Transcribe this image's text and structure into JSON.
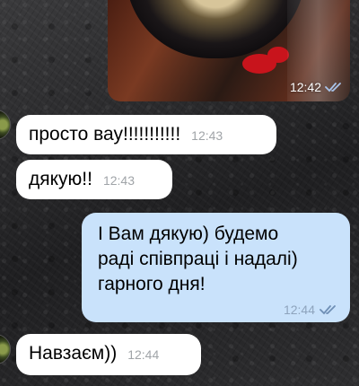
{
  "colors": {
    "incoming_bubble": "#ffffff",
    "outgoing_bubble": "#c9e2fb",
    "read_check": "#6f8fb5",
    "timestamp": "#a0a4a8"
  },
  "messages": [
    {
      "id": "photo",
      "direction": "outgoing",
      "type": "photo",
      "time": "12:42",
      "status_icon": "double-check-icon"
    },
    {
      "id": "m1",
      "direction": "incoming",
      "text": "просто вау!!!!!!!!!!!",
      "time": "12:43"
    },
    {
      "id": "m2",
      "direction": "incoming",
      "text": "дякую!!",
      "time": "12:43"
    },
    {
      "id": "m3",
      "direction": "outgoing",
      "text": "І Вам дякую) будемо\nраді співпраці і надалі)\nгарного дня!",
      "time": "12:44",
      "status_icon": "double-check-icon"
    },
    {
      "id": "m4",
      "direction": "incoming",
      "text": "Навзаєм))",
      "time": "12:44"
    }
  ]
}
